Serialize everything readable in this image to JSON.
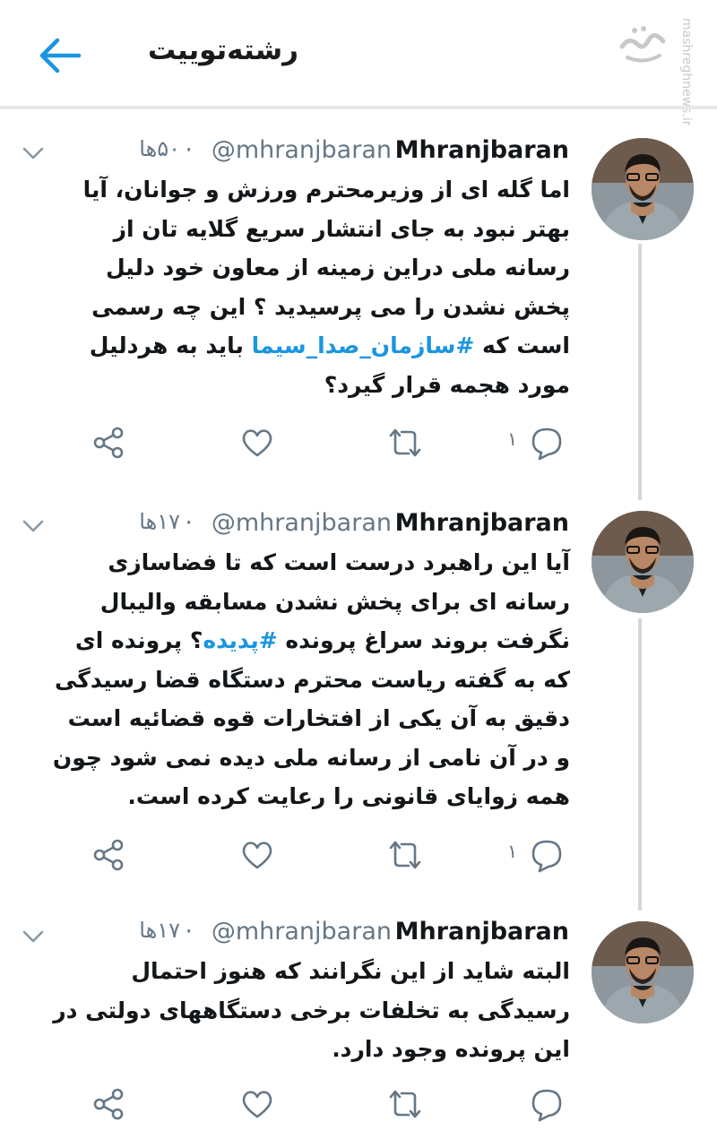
{
  "header": {
    "title": "رشته‌توییت",
    "back_icon": "arrow-left-icon",
    "watermark": "mashreghnews.ir"
  },
  "colors": {
    "accent": "#1b95e0",
    "muted": "#657786",
    "thread_line": "#cfd9de"
  },
  "tweets": [
    {
      "name": "Mhranjbaran",
      "handle": "@mhranjbaran",
      "dot": "·",
      "time": "۵۰ها",
      "text_before": "اما گله ای از وزیرمحترم ورزش و جوانان، آیا بهتر نبود به جای انتشار سریع گلایه تان از رسانه ملی دراین زمینه از معاون خود دلیل پخش نشدن را می پرسیدید ؟ این چه رسمی است که ",
      "hashtag": "#سازمان_صدا_سیما",
      "text_after": " باید به هردلیل مورد هجمه قرار گیرد؟",
      "reply_count": "۱"
    },
    {
      "name": "Mhranjbaran",
      "handle": "@mhranjbaran",
      "dot": "·",
      "time": "۱۷ها",
      "text_before": "آیا این راهبرد درست است که تا فضاسازی رسانه ای برای پخش نشدن مسابقه والیبال نگرفت بروند سراغ پرونده ",
      "hashtag": "#پدیده",
      "text_after": "؟ پرونده ای که به گفته ریاست محترم دستگاه قضا رسیدگی دقیق به آن یکی از افتخارات قوه قضائیه است و در آن نامی از رسانه ملی دیده نمی شود چون همه زوایای قانونی را رعایت کرده است.",
      "reply_count": "۱"
    },
    {
      "name": "Mhranjbaran",
      "handle": "@mhranjbaran",
      "dot": "·",
      "time": "۱۷ها",
      "text_before": "البته شاید از این نگرانند که هنوز احتمال رسیدگی به تخلفات برخی دستگاههای دولتی در این پرونده وجود دارد.",
      "hashtag": "",
      "text_after": "",
      "reply_count": ""
    }
  ]
}
